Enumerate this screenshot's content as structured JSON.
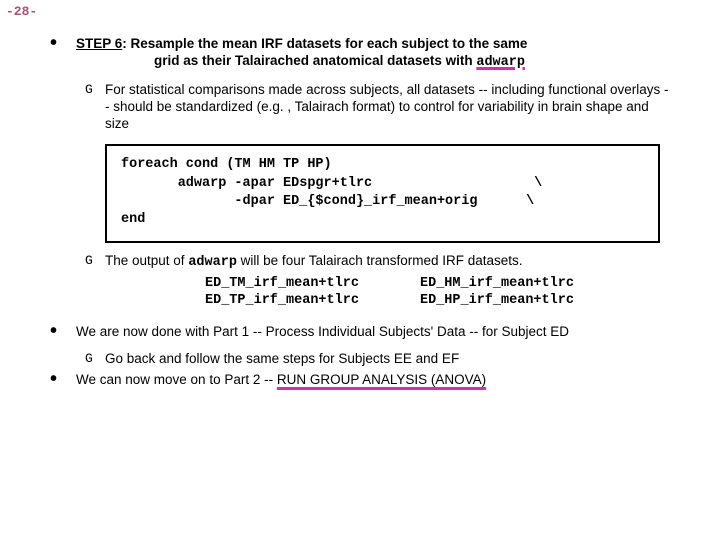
{
  "page_number": "-28-",
  "step6": {
    "label": "STEP 6",
    "text_a": ": Resample the mean IRF datasets for each subject to the same",
    "text_b": "grid as their Talairached anatomical datasets with ",
    "cmd": "adwarp"
  },
  "sub1": "For statistical comparisons made across subjects, all datasets -- including functional overlays -- should be standardized (e.g. , Talairach format) to control for variability in brain shape and size",
  "code": "foreach cond (TM HM TP HP)\n       adwarp -apar EDspgr+tlrc                    \\\n              -dpar ED_{$cond}_irf_mean+orig      \\\nend",
  "sub2_a": "The output of ",
  "sub2_cmd": "adwarp",
  "sub2_b": " will be four Talairach transformed IRF datasets.",
  "out": {
    "r1c1": "ED_TM_irf_mean+tlrc",
    "r1c2": "ED_HM_irf_mean+tlrc",
    "r2c1": "ED_TP_irf_mean+tlrc",
    "r2c2": "ED_HP_irf_mean+tlrc"
  },
  "done_part1": "We are now done with Part 1 -- Process Individual Subjects' Data -- for Subject ED",
  "goback": "Go back and follow the same steps for Subjects EE and EF",
  "part2_a": "We can now move on to Part 2 -- ",
  "part2_b": "RUN GROUP ANALYSIS (ANOVA)"
}
